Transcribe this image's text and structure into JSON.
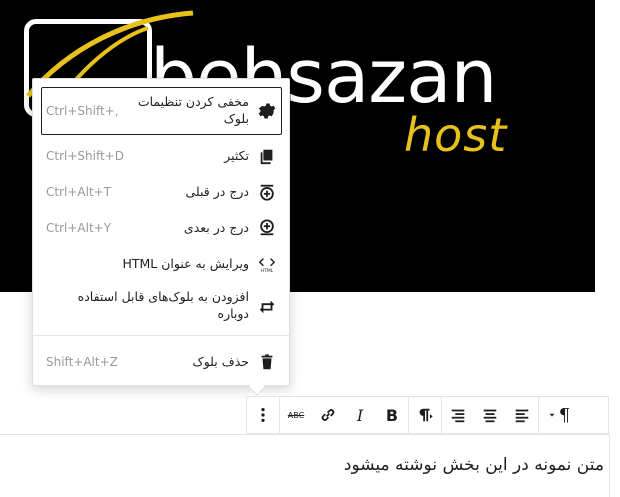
{
  "banner": {
    "logo_word": "behsazan",
    "logo_sub": "host",
    "colors": {
      "background": "#000000",
      "accent": "#e8c21a",
      "text": "#ffffff"
    }
  },
  "block_menu": {
    "items": [
      {
        "label": "مخفی کردن تنظیمات بلوک",
        "shortcut": "Ctrl+Shift+,",
        "icon": "gear-icon"
      },
      {
        "label": "تکثیر",
        "shortcut": "Ctrl+Shift+D",
        "icon": "copy-icon"
      },
      {
        "label": "درج در قبلی",
        "shortcut": "Ctrl+Alt+T",
        "icon": "insert-before-icon"
      },
      {
        "label": "درج در بعدی",
        "shortcut": "Ctrl+Alt+Y",
        "icon": "insert-after-icon"
      },
      {
        "label": "ویرایش به عنوان HTML",
        "shortcut": "",
        "icon": "html-icon"
      },
      {
        "label": "افزودن به بلوک‌های قابل استفاده دوباره",
        "shortcut": "",
        "icon": "reusable-icon"
      }
    ],
    "remove": {
      "label": "حذف بلوک",
      "shortcut": "Shift+Alt+Z",
      "icon": "trash-icon"
    }
  },
  "toolbar": {
    "more_icon": "more-vertical-icon",
    "strikethrough_label": "ABC",
    "italic_label": "I",
    "bold_label": "B",
    "paragraph_label": "¶"
  },
  "editor": {
    "paragraph_text": "متن نمونه در این بخش نوشته میشود"
  }
}
